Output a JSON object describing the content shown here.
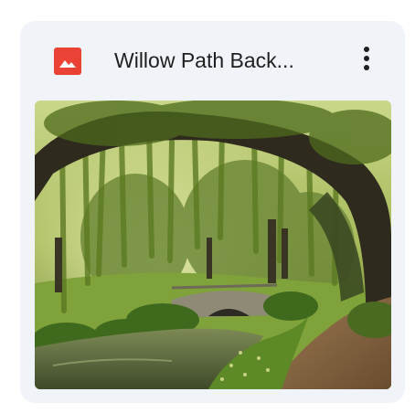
{
  "file_card": {
    "title": "Willow Path Back...",
    "file_type_icon": "image-file-icon",
    "file_type_color": "#ea4335",
    "menu_icon": "more-vert-icon",
    "card_background": "#f0f4f9"
  },
  "thumbnail": {
    "description_icon": "willow-park-image"
  }
}
